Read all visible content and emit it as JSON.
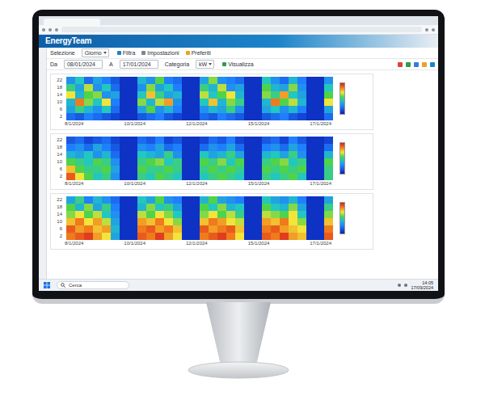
{
  "app": {
    "logo": "EnergyTeam"
  },
  "toolbar": {
    "selection_label": "Selezione",
    "selection_value": "Giorno",
    "buttons": [
      "Filtra",
      "Impostazioni",
      "Preferiti"
    ],
    "from_label": "Da",
    "from_value": "08/01/2024",
    "to_label": "A",
    "to_value": "17/01/2024",
    "category_label": "Categoria",
    "category_value": "kW",
    "show_button": "Visualizza"
  },
  "charts": [
    {
      "y_ticks": [
        "22",
        "18",
        "14",
        "10",
        "6",
        "2"
      ],
      "x_ticks": [
        "8/1/2024",
        "10/1/2024",
        "12/1/2024",
        "15/1/2024",
        "17/1/2024"
      ],
      "rows": [
        [
          30,
          45,
          20,
          35,
          25,
          15,
          5,
          5,
          40,
          30,
          55,
          25,
          20,
          5,
          5,
          35,
          60,
          30,
          25,
          20,
          5,
          5,
          45,
          30,
          20,
          40,
          25,
          5,
          5,
          30
        ],
        [
          50,
          35,
          65,
          30,
          45,
          20,
          5,
          5,
          30,
          60,
          35,
          45,
          25,
          5,
          5,
          50,
          40,
          65,
          30,
          35,
          5,
          5,
          55,
          40,
          35,
          60,
          30,
          5,
          5,
          45
        ],
        [
          70,
          40,
          55,
          60,
          30,
          35,
          5,
          5,
          45,
          75,
          50,
          35,
          40,
          5,
          5,
          65,
          45,
          55,
          70,
          40,
          5,
          5,
          60,
          50,
          80,
          45,
          35,
          5,
          5,
          55
        ],
        [
          40,
          85,
          60,
          45,
          70,
          25,
          5,
          5,
          60,
          40,
          65,
          80,
          30,
          5,
          5,
          45,
          75,
          40,
          60,
          50,
          5,
          5,
          40,
          85,
          55,
          65,
          40,
          5,
          5,
          70
        ],
        [
          35,
          50,
          40,
          30,
          45,
          20,
          5,
          5,
          35,
          55,
          30,
          40,
          25,
          5,
          5,
          30,
          40,
          35,
          50,
          30,
          5,
          5,
          35,
          45,
          30,
          40,
          25,
          5,
          5,
          35
        ],
        [
          20,
          15,
          25,
          20,
          15,
          10,
          5,
          5,
          15,
          20,
          25,
          15,
          10,
          5,
          5,
          20,
          15,
          25,
          20,
          15,
          5,
          5,
          15,
          20,
          25,
          15,
          10,
          5,
          5,
          20
        ]
      ]
    },
    {
      "y_ticks": [
        "22",
        "18",
        "14",
        "10",
        "6",
        "2"
      ],
      "x_ticks": [
        "8/1/2024",
        "10/1/2024",
        "12/1/2024",
        "15/1/2024",
        "17/1/2024"
      ],
      "rows": [
        [
          15,
          20,
          10,
          15,
          20,
          10,
          5,
          5,
          20,
          15,
          25,
          10,
          15,
          5,
          5,
          10,
          20,
          15,
          25,
          10,
          5,
          5,
          15,
          20,
          10,
          25,
          15,
          5,
          5,
          10
        ],
        [
          25,
          30,
          20,
          35,
          25,
          15,
          5,
          5,
          30,
          25,
          35,
          20,
          25,
          5,
          5,
          20,
          30,
          25,
          35,
          20,
          5,
          5,
          25,
          30,
          20,
          35,
          25,
          5,
          5,
          20
        ],
        [
          40,
          35,
          45,
          30,
          40,
          20,
          5,
          5,
          45,
          40,
          35,
          50,
          30,
          5,
          5,
          45,
          35,
          40,
          50,
          35,
          5,
          5,
          40,
          45,
          35,
          50,
          30,
          5,
          5,
          40
        ],
        [
          55,
          50,
          45,
          55,
          50,
          30,
          5,
          5,
          50,
          55,
          60,
          45,
          50,
          5,
          5,
          55,
          50,
          60,
          45,
          55,
          5,
          5,
          50,
          55,
          60,
          45,
          50,
          5,
          5,
          55
        ],
        [
          75,
          55,
          50,
          50,
          55,
          35,
          5,
          5,
          55,
          50,
          50,
          55,
          50,
          5,
          5,
          50,
          55,
          50,
          55,
          50,
          5,
          5,
          55,
          50,
          55,
          50,
          55,
          5,
          5,
          50
        ],
        [
          90,
          70,
          55,
          45,
          50,
          30,
          5,
          5,
          50,
          45,
          55,
          50,
          45,
          5,
          5,
          45,
          50,
          55,
          50,
          45,
          5,
          5,
          50,
          45,
          50,
          55,
          45,
          5,
          5,
          50
        ]
      ]
    },
    {
      "y_ticks": [
        "22",
        "18",
        "14",
        "10",
        "6",
        "2"
      ],
      "x_ticks": [
        "8/1/2024",
        "10/1/2024",
        "12/1/2024",
        "15/1/2024",
        "17/1/2024"
      ],
      "rows": [
        [
          35,
          50,
          25,
          40,
          30,
          20,
          5,
          5,
          45,
          35,
          55,
          30,
          25,
          5,
          5,
          40,
          55,
          35,
          30,
          25,
          5,
          5,
          45,
          35,
          30,
          40,
          25,
          5,
          5,
          35
        ],
        [
          55,
          40,
          60,
          35,
          50,
          25,
          5,
          5,
          40,
          60,
          45,
          50,
          35,
          5,
          5,
          55,
          45,
          60,
          40,
          45,
          5,
          5,
          55,
          45,
          40,
          60,
          35,
          5,
          5,
          50
        ],
        [
          60,
          70,
          55,
          65,
          45,
          30,
          5,
          5,
          65,
          55,
          70,
          60,
          45,
          5,
          5,
          60,
          70,
          55,
          65,
          50,
          5,
          5,
          65,
          60,
          55,
          70,
          45,
          5,
          5,
          60
        ],
        [
          75,
          85,
          70,
          80,
          65,
          35,
          5,
          5,
          80,
          75,
          85,
          70,
          60,
          5,
          5,
          75,
          85,
          80,
          70,
          65,
          5,
          5,
          80,
          75,
          85,
          70,
          60,
          5,
          5,
          75
        ],
        [
          90,
          80,
          85,
          75,
          80,
          40,
          5,
          5,
          85,
          90,
          80,
          85,
          75,
          5,
          5,
          90,
          80,
          85,
          90,
          75,
          5,
          5,
          85,
          90,
          80,
          75,
          70,
          5,
          5,
          85
        ],
        [
          85,
          90,
          95,
          80,
          70,
          35,
          5,
          5,
          90,
          85,
          95,
          80,
          70,
          5,
          5,
          85,
          90,
          95,
          85,
          70,
          5,
          5,
          90,
          85,
          95,
          80,
          75,
          5,
          5,
          90
        ]
      ]
    }
  ],
  "taskbar": {
    "search_placeholder": "Cerca",
    "time": "14:05",
    "date": "17/09/2024"
  }
}
